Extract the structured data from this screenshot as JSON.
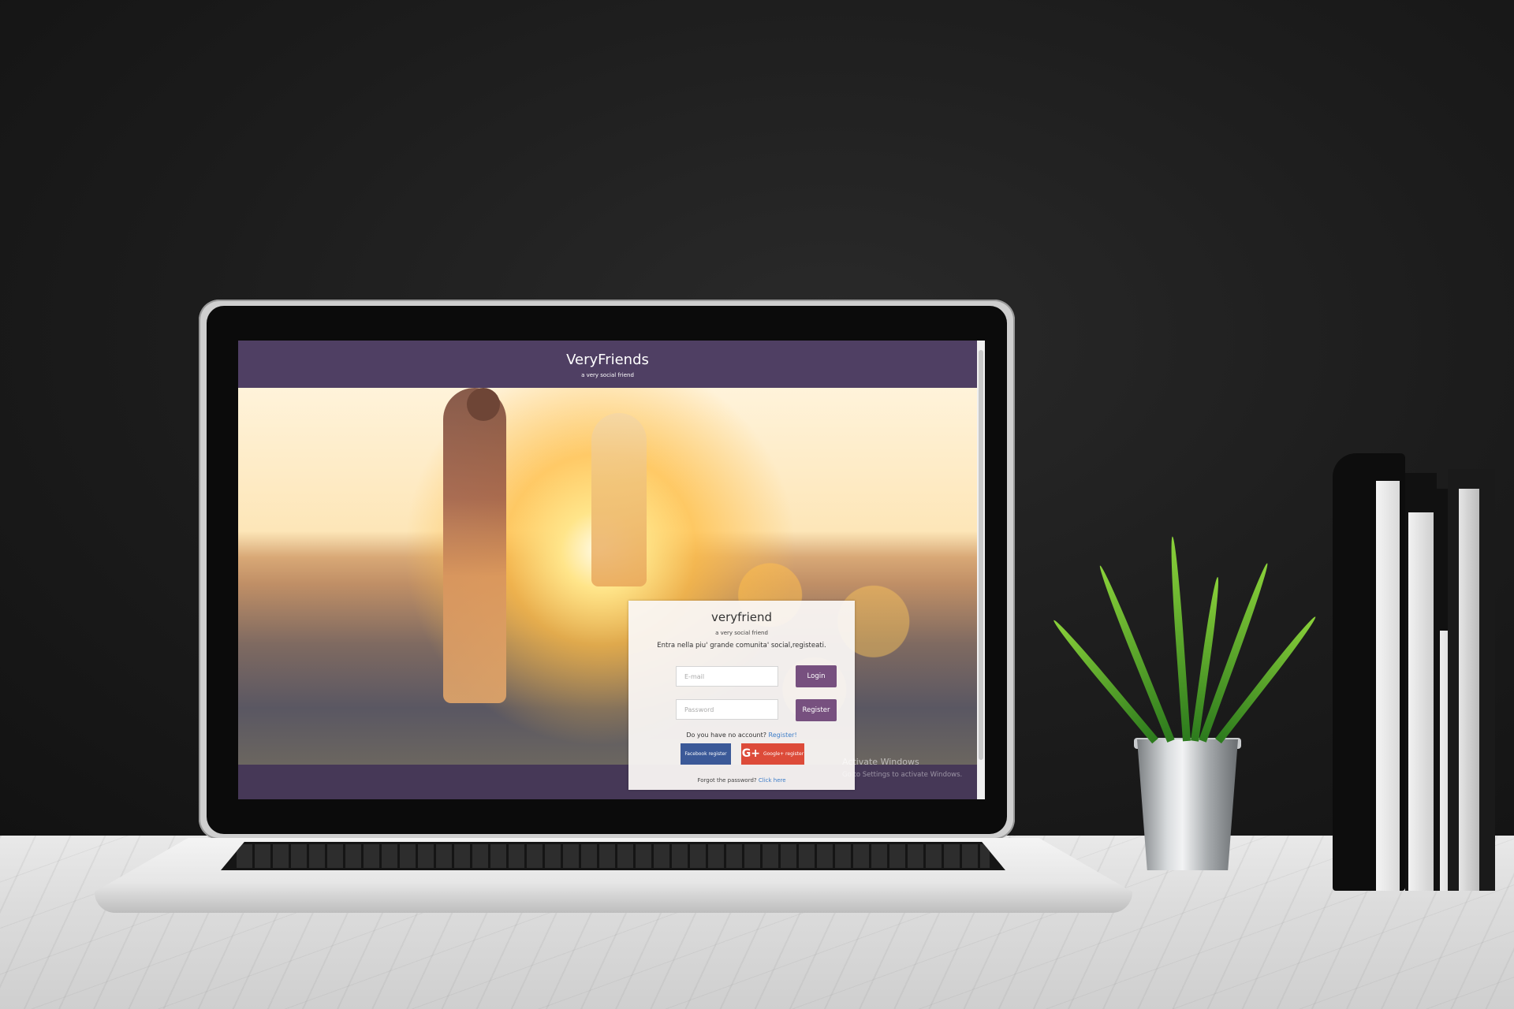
{
  "app": {
    "brand": "VeryFriends",
    "tagline": "a very social friend"
  },
  "login_card": {
    "title": "veryfriend",
    "subtitle": "a very social friend",
    "intro": "Entra nella piu' grande comunita' social,registeati.",
    "email_placeholder": "E-mail",
    "password_placeholder": "Password",
    "login_label": "Login",
    "register_label": "Register",
    "no_account_text": "Do you have no account?",
    "register_link": "Register!",
    "facebook_label": "Facebook register",
    "google_icon": "G+",
    "google_label": "Google+ register",
    "forgot_text": "Forgot the password?",
    "forgot_link": "Click here"
  },
  "watermark": {
    "line1": "Activate Windows",
    "line2": "Go to Settings to activate Windows."
  },
  "colors": {
    "header": "#4f3f63",
    "button": "#77507f",
    "facebook": "#3b5998",
    "google": "#dd4b39",
    "link": "#3d7dc8"
  }
}
